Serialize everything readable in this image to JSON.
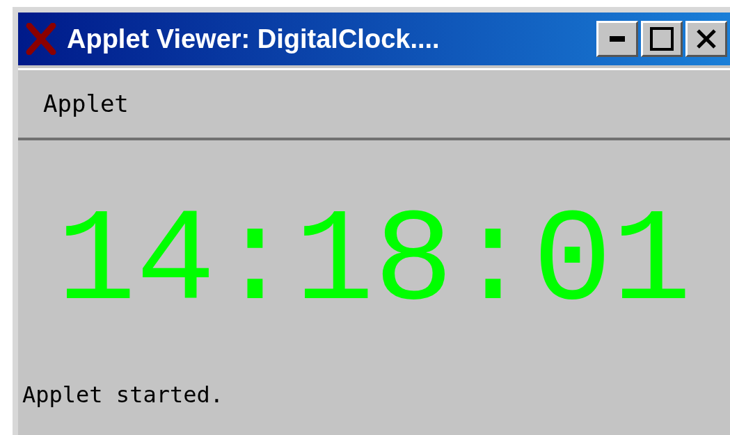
{
  "window": {
    "title": "Applet Viewer: DigitalClock...."
  },
  "menu": [
    {
      "label": "Applet"
    }
  ],
  "clock": {
    "time": "14:18:01"
  },
  "status_bar": {
    "text": "Applet started."
  }
}
